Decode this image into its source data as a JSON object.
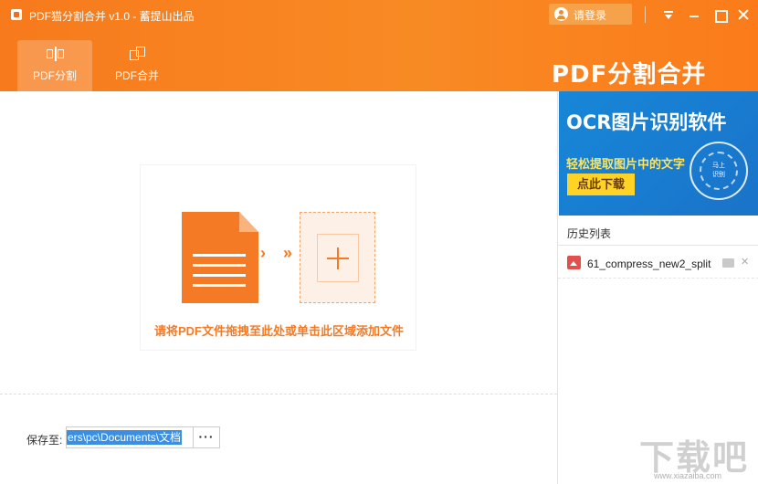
{
  "app": {
    "title": "PDF猫分割合并 v1.0 - 蓄提山出品",
    "brand_text": "PDF分割合并",
    "accent_color": "#f47a25"
  },
  "titlebar": {
    "login_label": "请登录",
    "buttons": [
      "menu-icon",
      "minimize-icon",
      "maximize-icon",
      "close-icon"
    ]
  },
  "tabs": [
    {
      "label": "PDF分割",
      "icon": "split-icon",
      "active": true
    },
    {
      "label": "PDF合并",
      "icon": "merge-icon",
      "active": false
    }
  ],
  "dropzone": {
    "text": "请将PDF文件拖拽至此处或单击此区域添加文件",
    "arrow1": "›",
    "arrow2": "»"
  },
  "save": {
    "label": "保存至:",
    "path": "ers\\pc\\Documents\\文档",
    "browse_label": "···"
  },
  "ad": {
    "title": "OCR图片识别软件",
    "subtitle": "轻松提取图片中的文字",
    "button": "点此下载",
    "badge_line1": "马上",
    "badge_line2": "识别"
  },
  "history": {
    "title": "历史列表",
    "items": [
      {
        "name": "61_compress_new2_split"
      }
    ]
  },
  "watermark": {
    "text": "下载吧",
    "url": "www.xiazaiba.com"
  }
}
